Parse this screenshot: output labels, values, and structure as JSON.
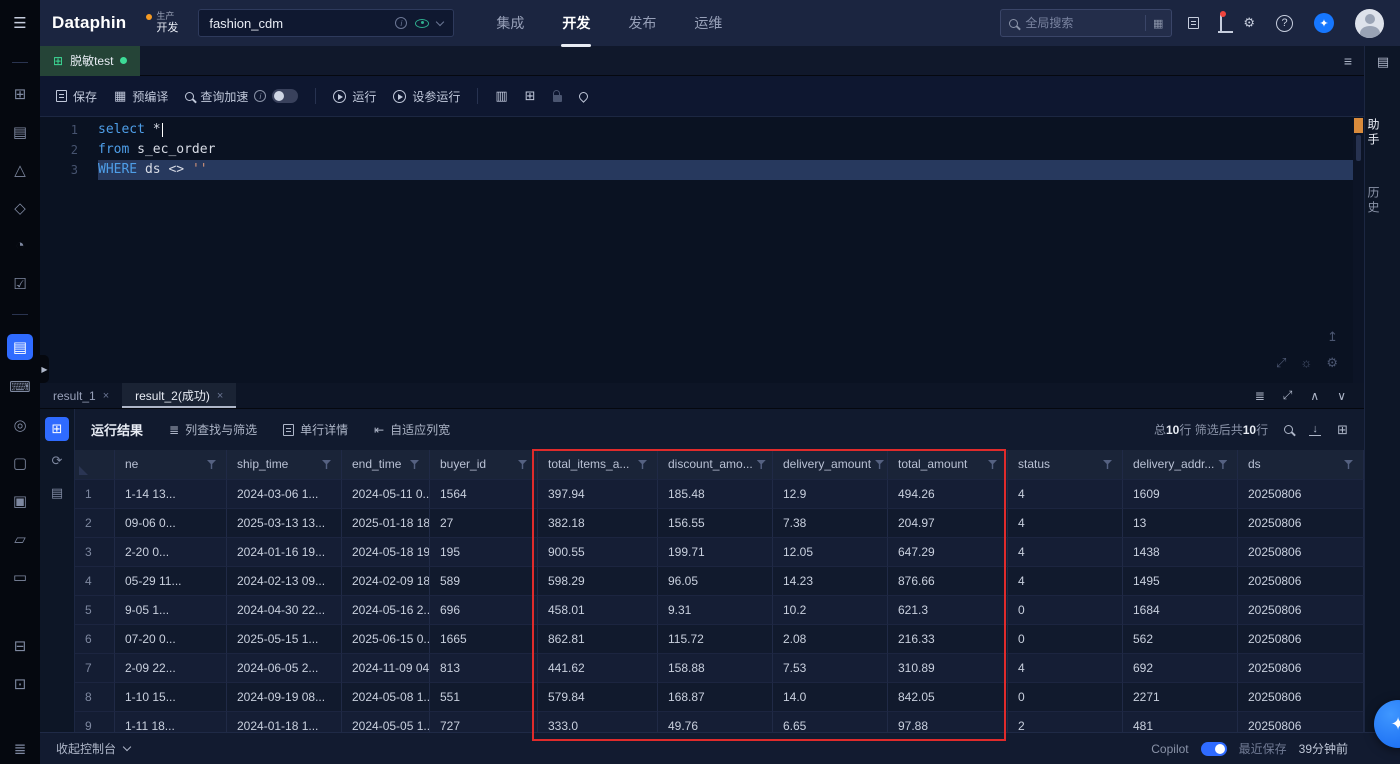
{
  "colors": {
    "accent_blue": "#2F6BFF",
    "annotation_red": "#E02B2B",
    "tab_green": "#3DDC97",
    "keyword_blue": "#4E9EE8",
    "string_orange": "#CE9178"
  },
  "topnav": {
    "logo": "Dataphin",
    "env_top": "生产",
    "env_bottom": "开发",
    "project_name": "fashion_cdm",
    "nav_items": [
      {
        "label": "集成",
        "active": false
      },
      {
        "label": "开发",
        "active": true
      },
      {
        "label": "发布",
        "active": false
      },
      {
        "label": "运维",
        "active": false
      }
    ],
    "search_placeholder": "全局搜索",
    "help_glyph": "?"
  },
  "left_rail": {
    "icons": [
      {
        "name": "divider"
      },
      {
        "name": "overview-icon",
        "glyph": "⊞"
      },
      {
        "name": "notebook-icon",
        "glyph": "▤"
      },
      {
        "name": "alert-icon",
        "glyph": "△"
      },
      {
        "name": "model-icon",
        "glyph": "◇"
      },
      {
        "name": "analytics-icon",
        "glyph": "◔"
      },
      {
        "name": "task-icon",
        "glyph": "☑"
      },
      {
        "name": "divider"
      },
      {
        "name": "script-icon",
        "glyph": "▤",
        "active": true
      },
      {
        "name": "terminal-icon",
        "glyph": "⌨"
      },
      {
        "name": "compass-icon",
        "glyph": "◎"
      },
      {
        "name": "resource-icon",
        "glyph": "▢"
      },
      {
        "name": "board-icon",
        "glyph": "▣"
      },
      {
        "name": "folder-icon",
        "glyph": "▱"
      },
      {
        "name": "trash-icon",
        "glyph": "▭"
      },
      {
        "name": "archive-icon",
        "glyph": "⊟",
        "spaced": true
      },
      {
        "name": "package-icon",
        "glyph": "⊡"
      }
    ],
    "bottom_glyph": "≣"
  },
  "file_tab": {
    "label": "脱敏test"
  },
  "toolbar": {
    "save": "保存",
    "precompile": "预编译",
    "query_accel": "查询加速",
    "run": "运行",
    "param_run": "设参运行"
  },
  "editor": {
    "lines": [
      {
        "no": "1",
        "selected": false,
        "caret": true,
        "tokens": [
          {
            "text": "select",
            "type": "kw"
          },
          {
            "text": " *",
            "type": "plain"
          }
        ]
      },
      {
        "no": "2",
        "selected": false,
        "caret": false,
        "tokens": [
          {
            "text": "from",
            "type": "kw"
          },
          {
            "text": " s_ec_order",
            "type": "plain"
          }
        ]
      },
      {
        "no": "3",
        "selected": true,
        "caret": false,
        "tokens": [
          {
            "text": "WHERE",
            "type": "kw"
          },
          {
            "text": " ds <> ",
            "type": "plain"
          },
          {
            "text": "''",
            "type": "str"
          }
        ]
      }
    ]
  },
  "right_rail": {
    "assistant": "助手",
    "history": "历史"
  },
  "results": {
    "tabs": [
      {
        "label": "result_1",
        "active": false
      },
      {
        "label": "result_2(成功)",
        "active": true
      }
    ],
    "tab_icons": [
      {
        "name": "result-menu-icon",
        "glyph": "≣"
      },
      {
        "name": "result-expand-icon",
        "glyph": "⤢"
      },
      {
        "name": "panel-up-icon",
        "glyph": "∧"
      },
      {
        "name": "panel-down-icon",
        "glyph": "∨"
      }
    ],
    "mini_rail": [
      {
        "name": "grid-view-icon",
        "glyph": "⊞",
        "active": true
      },
      {
        "name": "run-history-icon",
        "glyph": "⟳",
        "active": false
      },
      {
        "name": "schedule-view-icon",
        "glyph": "▤",
        "active": false
      }
    ],
    "toolbar": {
      "title": "运行结果",
      "col_filter": "列查找与筛选",
      "row_detail": "单行详情",
      "fit_width": "自适应列宽",
      "total_prefix": "总",
      "total_count": "10",
      "total_suffix": "行",
      "filtered_prefix": "筛选后共",
      "filtered_count": "10",
      "filtered_suffix": "行"
    },
    "table": {
      "columns": [
        "ne",
        "ship_time",
        "end_time",
        "buyer_id",
        "total_items_a...",
        "discount_amo...",
        "delivery_amount",
        "total_amount",
        "status",
        "delivery_addr...",
        "ds"
      ],
      "rows": [
        [
          "1",
          "1-14 13...",
          "2024-03-06 1...",
          "2024-05-11 0...",
          "1564",
          "397.94",
          "185.48",
          "12.9",
          "494.26",
          "4",
          "1609",
          "20250806"
        ],
        [
          "2",
          "09-06 0...",
          "2025-03-13 13...",
          "2025-01-18 18...",
          "27",
          "382.18",
          "156.55",
          "7.38",
          "204.97",
          "4",
          "13",
          "20250806"
        ],
        [
          "3",
          "2-20 0...",
          "2024-01-16 19...",
          "2024-05-18 19...",
          "195",
          "900.55",
          "199.71",
          "12.05",
          "647.29",
          "4",
          "1438",
          "20250806"
        ],
        [
          "4",
          "05-29 11...",
          "2024-02-13 09...",
          "2024-02-09 18...",
          "589",
          "598.29",
          "96.05",
          "14.23",
          "876.66",
          "4",
          "1495",
          "20250806"
        ],
        [
          "5",
          "9-05 1...",
          "2024-04-30 22...",
          "2024-05-16 2...",
          "696",
          "458.01",
          "9.31",
          "10.2",
          "621.3",
          "0",
          "1684",
          "20250806"
        ],
        [
          "6",
          "07-20 0...",
          "2025-05-15 1...",
          "2025-06-15 0...",
          "1665",
          "862.81",
          "115.72",
          "2.08",
          "216.33",
          "0",
          "562",
          "20250806"
        ],
        [
          "7",
          "2-09 22...",
          "2024-06-05 2...",
          "2024-11-09 04...",
          "813",
          "441.62",
          "158.88",
          "7.53",
          "310.89",
          "4",
          "692",
          "20250806"
        ],
        [
          "8",
          "1-10 15...",
          "2024-09-19 08...",
          "2024-05-08 1...",
          "551",
          "579.84",
          "168.87",
          "14.0",
          "842.05",
          "0",
          "2271",
          "20250806"
        ],
        [
          "9",
          "1-11 18...",
          "2024-01-18 1...",
          "2024-05-05 1...",
          "727",
          "333.0",
          "49.76",
          "6.65",
          "97.88",
          "2",
          "481",
          "20250806"
        ]
      ]
    }
  },
  "bottom_bar": {
    "collapse": "收起控制台",
    "copilot": "Copilot",
    "last_saved_label": "最近保存",
    "last_saved_time": "39分钟前"
  }
}
